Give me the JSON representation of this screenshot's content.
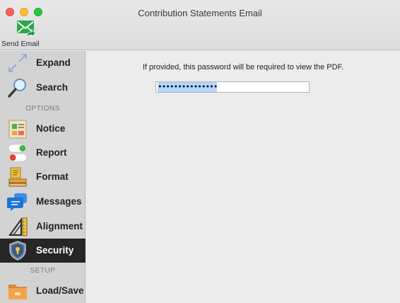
{
  "window": {
    "title": "Contribution Statements Email"
  },
  "toolbar": {
    "send_email_label": "Send Email",
    "send_email_icon": "send-email-icon"
  },
  "sidebar": {
    "items": [
      {
        "id": "expand",
        "label": "Expand",
        "icon": "expand-icon"
      },
      {
        "id": "search",
        "label": "Search",
        "icon": "search-icon"
      },
      {
        "id": "notice",
        "label": "Notice",
        "icon": "notice-icon"
      },
      {
        "id": "report",
        "label": "Report",
        "icon": "report-toggle-icon"
      },
      {
        "id": "format",
        "label": "Format",
        "icon": "format-icon"
      },
      {
        "id": "messages",
        "label": "Messages",
        "icon": "messages-icon"
      },
      {
        "id": "alignment",
        "label": "Alignment",
        "icon": "alignment-icon"
      },
      {
        "id": "security",
        "label": "Security",
        "icon": "security-shield-icon",
        "active": true
      },
      {
        "id": "loadsave",
        "label": "Load/Save",
        "icon": "folder-icon"
      }
    ],
    "headers": {
      "options": "OPTIONS",
      "setup": "SETUP"
    }
  },
  "main": {
    "password_hint": "If provided, this password will be required to view the PDF.",
    "password_value": "•••••••••••••••"
  },
  "colors": {
    "active_bg": "#262626",
    "selection": "#b3d7ff",
    "sidebar_bg": "#d3d3d3"
  }
}
